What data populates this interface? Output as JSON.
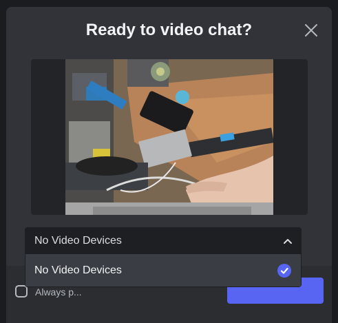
{
  "modal": {
    "title": "Ready to video chat?",
    "close_icon": "close-icon"
  },
  "device_select": {
    "value": "No Video Devices",
    "chevron_icon": "chevron-up-icon",
    "options": [
      {
        "label": "No Video Devices",
        "selected": true
      }
    ]
  },
  "footer": {
    "checkbox_label": "Always p..."
  },
  "colors": {
    "accent": "#5865f2",
    "modal_bg": "#313338",
    "footer_bg": "#2b2d31"
  }
}
